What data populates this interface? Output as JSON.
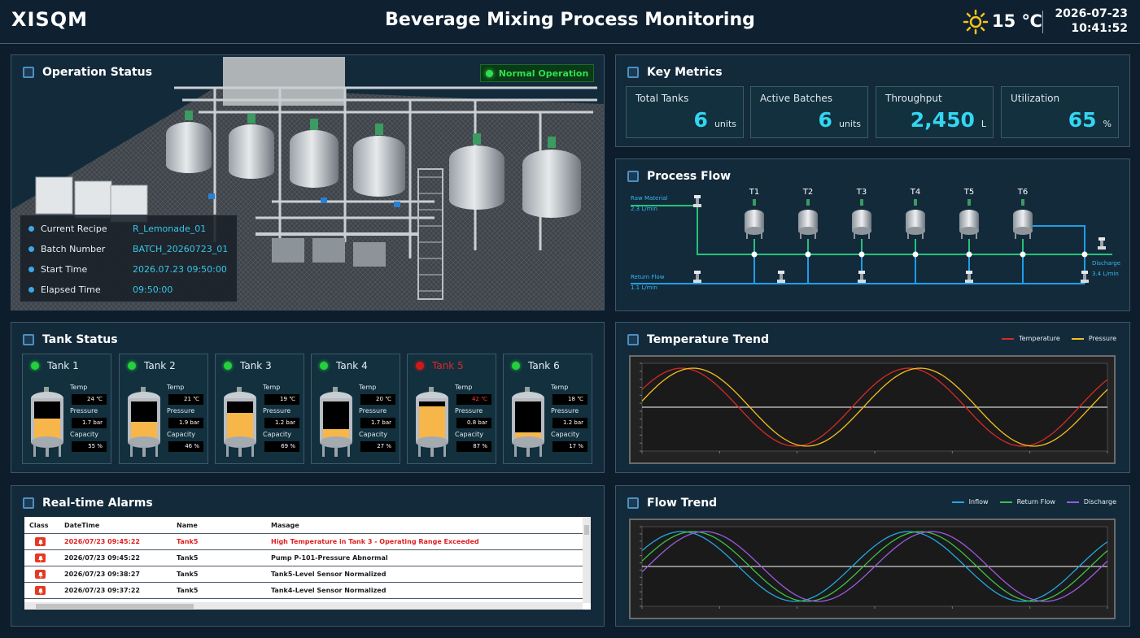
{
  "header": {
    "logo": "XISQM",
    "title": "Beverage Mixing Process Monitoring",
    "weather_icon": "sun-icon",
    "temperature": "15 ℃",
    "date": "2026-07-23",
    "time": "10:41:52"
  },
  "operation": {
    "title": "Operation Status",
    "status": "Normal Operation",
    "status_color": "#2fe04b",
    "info": [
      {
        "label": "Current Recipe",
        "value": "R_Lemonade_01"
      },
      {
        "label": "Batch Number",
        "value": "BATCH_20260723_01"
      },
      {
        "label": "Start Time",
        "value": "2026.07.23 09:50:00"
      },
      {
        "label": "Elapsed Time",
        "value": "09:50:00"
      }
    ]
  },
  "metrics": {
    "title": "Key Metrics",
    "items": [
      {
        "label": "Total Tanks",
        "value": "6",
        "unit": "units"
      },
      {
        "label": "Active Batches",
        "value": "6",
        "unit": "units"
      },
      {
        "label": "Throughput",
        "value": "2,450",
        "unit": "L"
      },
      {
        "label": "Utilization",
        "value": "65",
        "unit": "%"
      }
    ]
  },
  "process_flow": {
    "title": "Process Flow",
    "tanks": [
      "T1",
      "T2",
      "T3",
      "T4",
      "T5",
      "T6"
    ],
    "raw_material_label": "Raw Material",
    "raw_material_rate": "2.3 L/min",
    "return_flow_label": "Return Flow",
    "return_flow_rate": "1.1 L/min",
    "discharge_label": "Discharge",
    "discharge_rate": "3.4 L/min",
    "supply_line_color": "#25c27a",
    "return_line_color": "#1e9ee8"
  },
  "tank_status": {
    "title": "Tank Status",
    "labels": {
      "temp": "Temp",
      "pressure": "Pressure",
      "capacity": "Capacity"
    },
    "tanks": [
      {
        "name": "Tank 1",
        "status": "normal",
        "temp": "24 ℃",
        "pressure": "1.7 bar",
        "capacity": "55 %",
        "fill": 0.55
      },
      {
        "name": "Tank 2",
        "status": "normal",
        "temp": "21 ℃",
        "pressure": "1.9 bar",
        "capacity": "46 %",
        "fill": 0.46
      },
      {
        "name": "Tank 3",
        "status": "normal",
        "temp": "19 ℃",
        "pressure": "1.2 bar",
        "capacity": "69 %",
        "fill": 0.69
      },
      {
        "name": "Tank 4",
        "status": "normal",
        "temp": "20 ℃",
        "pressure": "1.7 bar",
        "capacity": "27 %",
        "fill": 0.27
      },
      {
        "name": "Tank 5",
        "status": "alarm",
        "temp": "42 ℃",
        "pressure": "0.8 bar",
        "capacity": "87 %",
        "fill": 0.87
      },
      {
        "name": "Tank 6",
        "status": "normal",
        "temp": "18 ℃",
        "pressure": "1.2 bar",
        "capacity": "17 %",
        "fill": 0.17
      }
    ],
    "fill_color": "#f7b64a",
    "alarm_color": "#e02727"
  },
  "alarms": {
    "title": "Real-time Alarms",
    "columns": [
      "Class",
      "DateTime",
      "Name",
      "Masage"
    ],
    "rows": [
      {
        "datetime": "2026/07/23 09:45:22",
        "name": "Tank5",
        "message": "High Temperature in Tank 3 - Operating Range Exceeded",
        "severity": "high"
      },
      {
        "datetime": "2026/07/23 09:45:22",
        "name": "Tank5",
        "message": "Pump P-101-Pressure Abnormal",
        "severity": "normal"
      },
      {
        "datetime": "2026/07/23 09:38:27",
        "name": "Tank5",
        "message": "Tank5-Level Sensor Normalized",
        "severity": "normal"
      },
      {
        "datetime": "2026/07/23 09:37:22",
        "name": "Tank5",
        "message": "Tank4-Level Sensor Normalized",
        "severity": "normal"
      }
    ]
  },
  "temperature_trend": {
    "title": "Temperature Trend",
    "legend": [
      {
        "name": "Temperature",
        "color": "#d42a2a"
      },
      {
        "name": "Pressure",
        "color": "#f2c01f"
      }
    ]
  },
  "flow_trend": {
    "title": "Flow Trend",
    "legend": [
      {
        "name": "Inflow",
        "color": "#22a8e0"
      },
      {
        "name": "Return Flow",
        "color": "#3fbf4a"
      },
      {
        "name": "Discharge",
        "color": "#9b5ae0"
      }
    ]
  }
}
